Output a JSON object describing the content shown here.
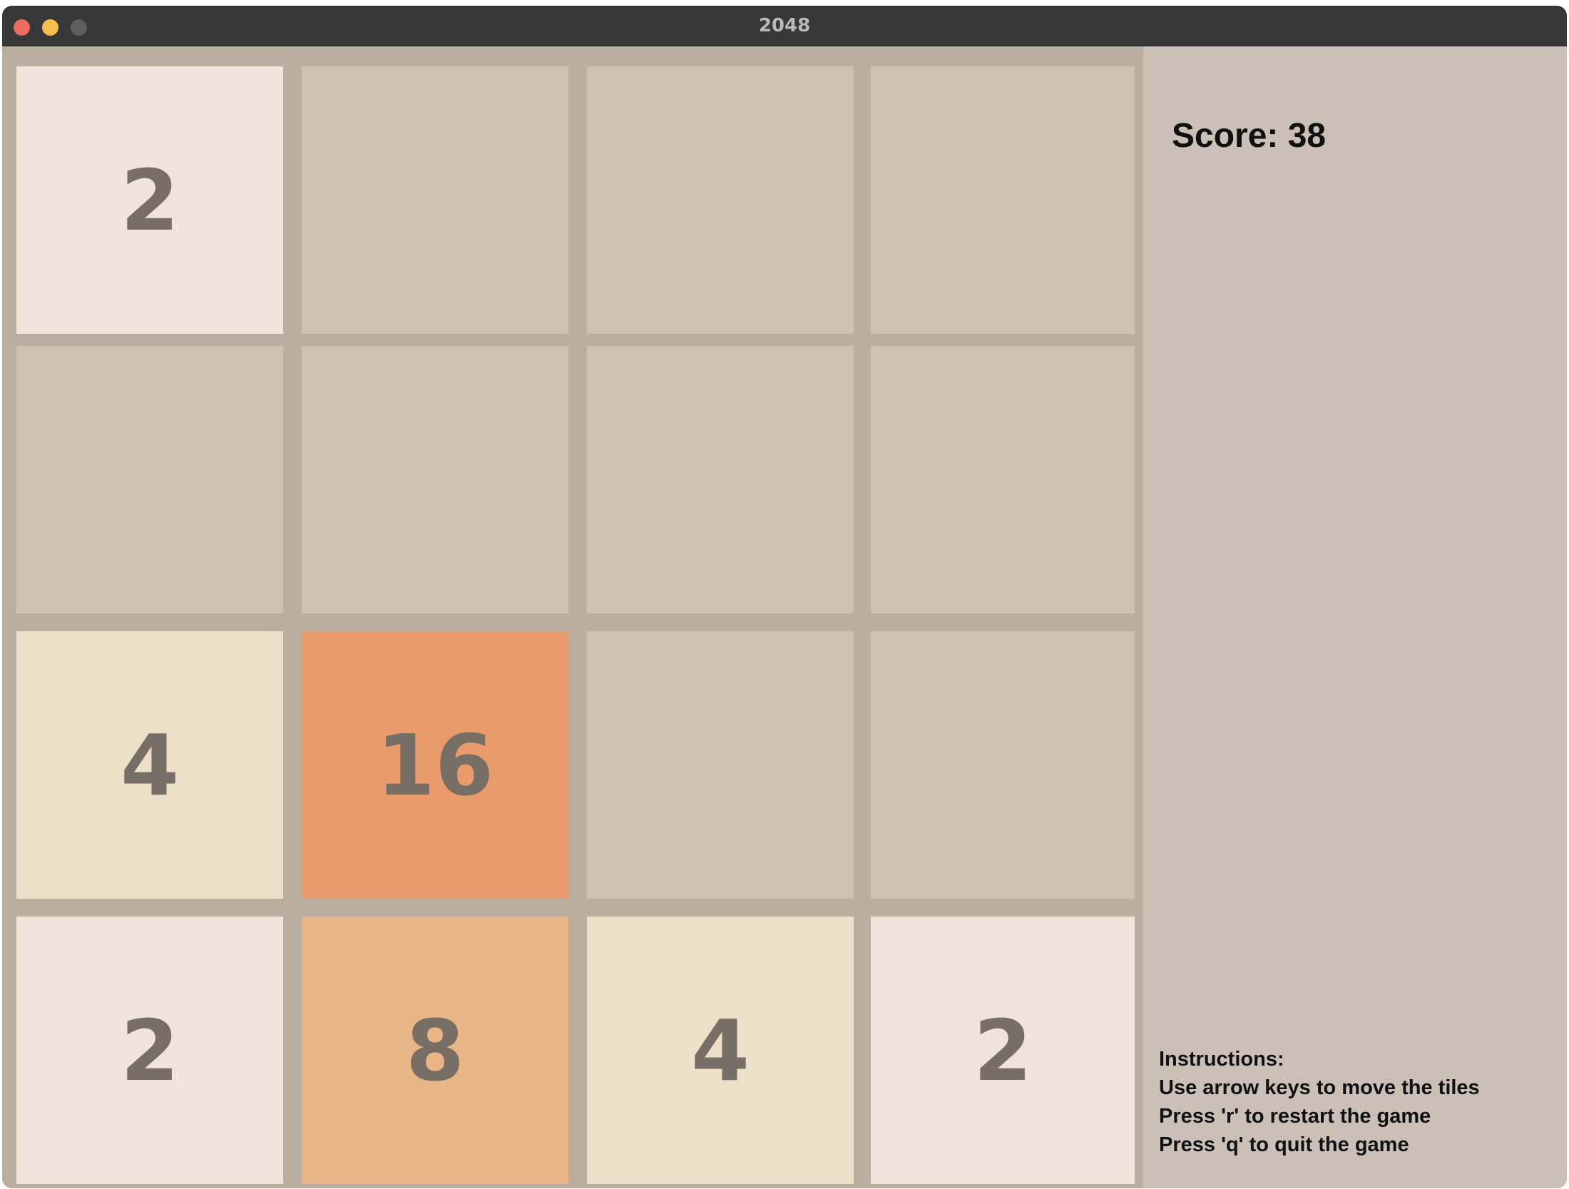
{
  "window": {
    "title": "2048"
  },
  "game": {
    "score_text": "Score: 38",
    "board": [
      [
        "2",
        "",
        "",
        ""
      ],
      [
        "",
        "",
        "",
        ""
      ],
      [
        "4",
        "16",
        "",
        ""
      ],
      [
        "2",
        "8",
        "4",
        "2"
      ]
    ]
  },
  "instructions": {
    "heading": "Instructions:",
    "lines": [
      "Use arrow keys to move the tiles",
      "Press 'r' to restart the game",
      "Press 'q' to quit the game"
    ]
  },
  "colors": {
    "board_background": "#bbada0",
    "empty_tile": "#cdc1b4",
    "tile_2": "#eee4da",
    "tile_4": "#ede0c8",
    "tile_8": "#e9b584",
    "tile_16": "#e99b6c",
    "tile_text": "#776e65",
    "panel_background": "#cbc0b5",
    "titlebar": "#383838"
  }
}
